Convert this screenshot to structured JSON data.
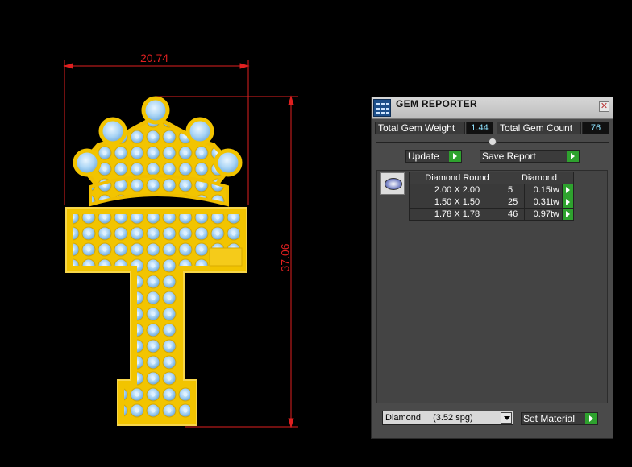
{
  "dimensions": {
    "width": "20.74",
    "height": "37.06"
  },
  "panel": {
    "title": "GEM REPORTER",
    "close": "✕",
    "total_weight_label": "Total Gem Weight",
    "total_weight_value": "1.44",
    "total_count_label": "Total Gem Count",
    "total_count_value": "76",
    "update_label": "Update",
    "save_report_label": "Save Report",
    "table": {
      "header_shape": "Diamond Round",
      "header_material": "Diamond",
      "rows": [
        {
          "size": "2.00 X 2.00",
          "count": "5",
          "weight": "0.15tw"
        },
        {
          "size": "1.50 X 1.50",
          "count": "25",
          "weight": "0.31tw"
        },
        {
          "size": "1.78 X 1.78",
          "count": "46",
          "weight": "0.97tw"
        }
      ]
    },
    "material_name": "Diamond",
    "material_spg": "(3.52 spg)",
    "set_material_label": "Set Material"
  },
  "colors": {
    "dimension_red": "#e02020",
    "gold": "#f5c400",
    "gem_blue": "#a9d4f5",
    "accent_green": "#2ea22e",
    "value_cyan": "#8fe3ff"
  },
  "icons": [
    "gem-reporter-app-icon",
    "close-icon",
    "play-arrow-icon",
    "dropdown-arrow-icon",
    "diamond-thumbnail-icon"
  ]
}
